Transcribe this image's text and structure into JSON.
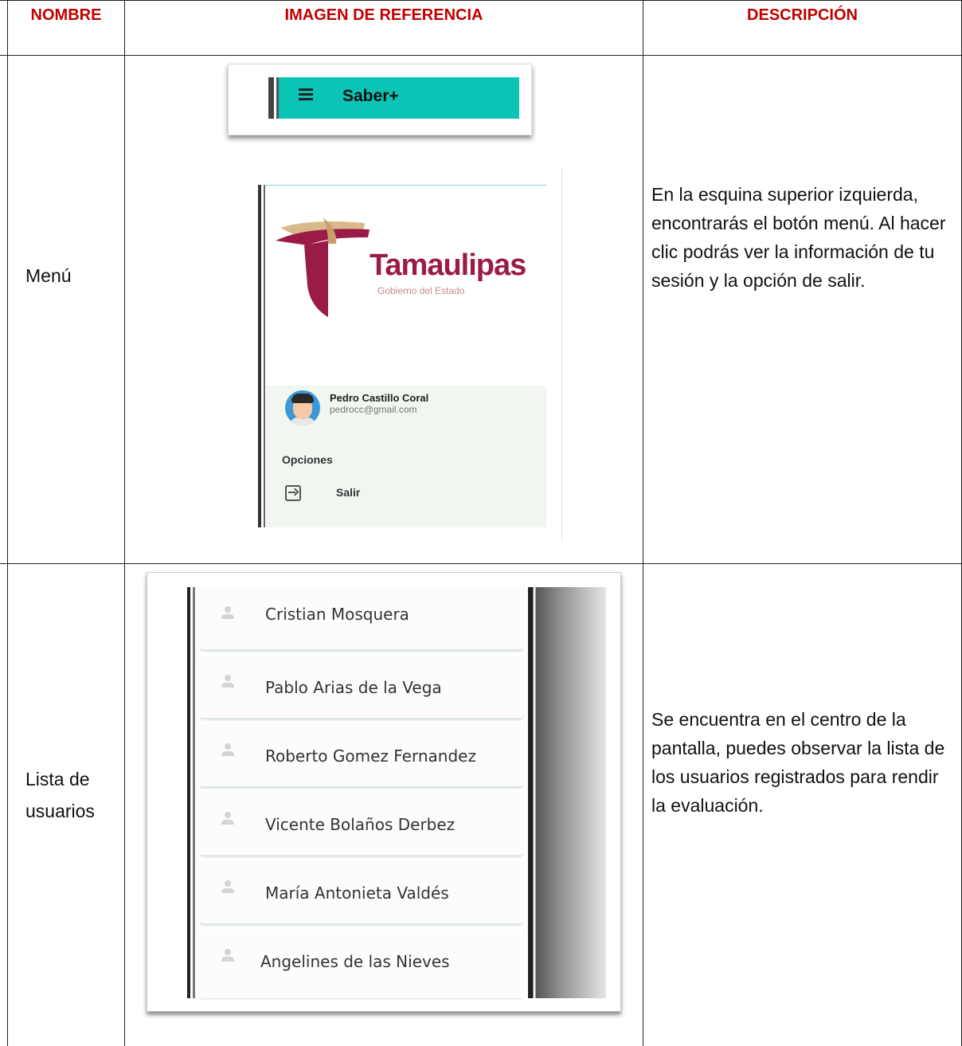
{
  "table": {
    "headers": {
      "nombre": "NOMBRE",
      "imagen": "IMAGEN DE REFERENCIA",
      "descripcion": "DESCRIPCIÓN"
    },
    "rows": [
      {
        "name": "Menú",
        "description": "En la esquina superior izquierda, encontrarás el botón menú. Al hacer clic podrás ver la información de tu sesión y la opción de salir."
      },
      {
        "name_line1": "Lista de",
        "name_line2": "usuarios",
        "description": "Se encuentra en el centro de la pantalla, puedes observar la lista de los usuarios registrados para rendir la evaluación."
      }
    ]
  },
  "menu_image": {
    "app_title": "Saber+",
    "logo_text": "Tamaulipas",
    "logo_sub": "Gobierno del Estado",
    "user_name": "Pedro Castillo Coral",
    "user_email": "pedrocc@gmail.com",
    "options_label": "Opciones",
    "exit_label": "Salir"
  },
  "user_list": [
    "Cristian Mosquera",
    "Pablo Arias de la Vega",
    "Roberto Gomez Fernandez",
    "Vicente Bolaños Derbez",
    "María Antonieta Valdés",
    "Angelines de las Nieves"
  ],
  "colors": {
    "header_red": "#c00000",
    "appbar_teal": "#0cc4b5",
    "logo_crimson": "#9b1b48"
  }
}
